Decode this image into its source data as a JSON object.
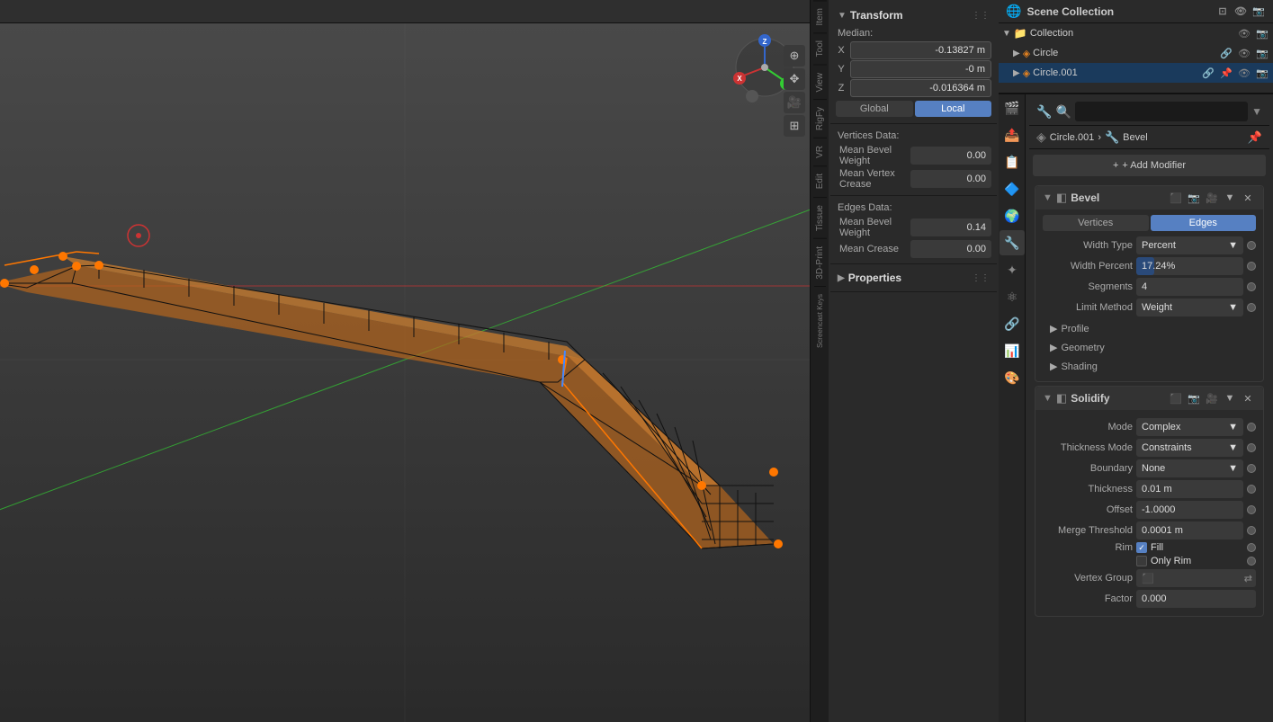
{
  "viewport": {
    "bg_color": "#3d3d3d"
  },
  "n_panel": {
    "tabs": [
      "Item",
      "Tool",
      "View",
      "RigFy",
      "VR",
      "Edit",
      "Tissue",
      "3D-Print",
      "Screencast Keys"
    ],
    "active_tab": "Item",
    "transform": {
      "title": "Transform",
      "median_label": "Median:",
      "x_label": "X",
      "x_value": "-0.13827 m",
      "y_label": "Y",
      "y_value": "-0 m",
      "z_label": "Z",
      "z_value": "-0.016364 m",
      "btn_global": "Global",
      "btn_local": "Local"
    },
    "vertices_data": {
      "title": "Vertices Data:",
      "mean_bevel_weight_label": "Mean Bevel Weight",
      "mean_bevel_weight_value": "0.00",
      "mean_vertex_crease_label": "Mean Vertex Crease",
      "mean_vertex_crease_value": "0.00"
    },
    "edges_data": {
      "title": "Edges Data:",
      "mean_bevel_weight_label": "Mean Bevel Weight",
      "mean_bevel_weight_value": "0.14",
      "mean_crease_label": "Mean Crease",
      "mean_crease_value": "0.00"
    },
    "properties": {
      "title": "Properties"
    }
  },
  "outliner": {
    "title": "Scene Collection",
    "items": [
      {
        "name": "Collection",
        "level": 0,
        "icon": "folder"
      },
      {
        "name": "Circle",
        "level": 1,
        "icon": "circle",
        "selected": false
      },
      {
        "name": "Circle.001",
        "level": 1,
        "icon": "circle",
        "selected": true
      }
    ]
  },
  "modifier_panel": {
    "object_name": "Circle.001",
    "modifier_name": "Bevel",
    "breadcrumb_arrow": "›",
    "add_modifier_label": "+ Add Modifier",
    "bevel": {
      "name": "Bevel",
      "tabs": [
        "Vertices",
        "Edges"
      ],
      "active_tab": "Edges",
      "fields": [
        {
          "label": "Width Type",
          "value": "Percent",
          "type": "select"
        },
        {
          "label": "Width Percent",
          "value": "17.24%",
          "type": "bar",
          "fill_pct": 17
        },
        {
          "label": "Segments",
          "value": "4",
          "type": "text"
        },
        {
          "label": "Limit Method",
          "value": "Weight",
          "type": "select"
        }
      ],
      "collapse_sections": [
        "Profile",
        "Geometry",
        "Shading"
      ]
    },
    "solidify": {
      "name": "Solidify",
      "fields": [
        {
          "label": "Mode",
          "value": "Complex",
          "type": "select"
        },
        {
          "label": "Thickness Mode",
          "value": "Constraints",
          "type": "select"
        },
        {
          "label": "Boundary",
          "value": "None",
          "type": "select"
        },
        {
          "label": "Thickness",
          "value": "0.01 m",
          "type": "text"
        },
        {
          "label": "Offset",
          "value": "-1.0000",
          "type": "text"
        },
        {
          "label": "Merge Threshold",
          "value": "0.0001 m",
          "type": "text"
        },
        {
          "label": "Rim",
          "value": "Fill",
          "type": "checkbox",
          "checked": true
        },
        {
          "label": "",
          "value": "Only Rim",
          "type": "checkbox2",
          "checked": false
        }
      ],
      "vertex_group_label": "Vertex Group",
      "factor_label": "Factor",
      "factor_value": "0.000"
    }
  },
  "gizmo": {
    "x_color": "#cc3333",
    "y_color": "#33cc33",
    "z_color": "#3366cc"
  }
}
